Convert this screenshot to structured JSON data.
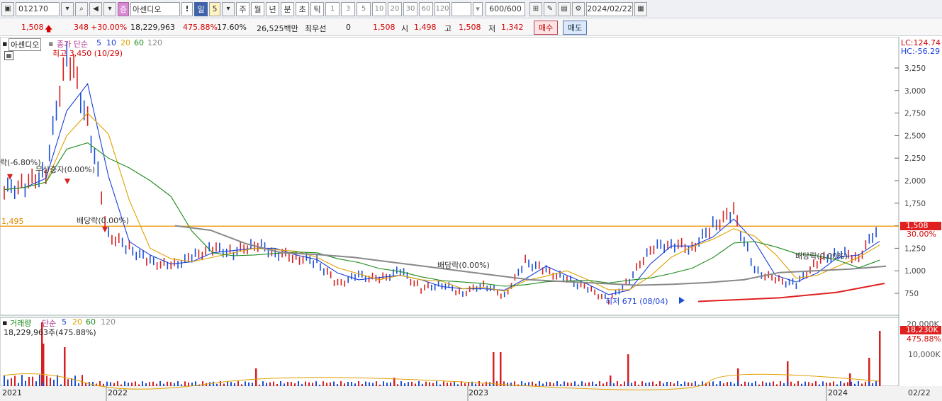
{
  "toolbar": {
    "stock_code": "012170",
    "stock_name": "아센디오",
    "badge": "증",
    "alert": "!",
    "period_day": "일",
    "period_value": "5",
    "period_week": "주",
    "period_month": "월",
    "period_year": "년",
    "period_minute": "분",
    "period_second": "초",
    "period_tick": "틱",
    "intervals": [
      "1",
      "3",
      "5",
      "10",
      "20",
      "30",
      "60",
      "120"
    ],
    "count": "600/600",
    "date": "2024/02/22"
  },
  "quote": {
    "price": "1,508",
    "change": "348",
    "change_pct": "+30.00%",
    "volume": "18,229,963",
    "volume_ratio": "475.88%",
    "turnover": "17.60%",
    "amount": "26,525백만",
    "best_bid_label": "최우선",
    "best_bid_qty": "0",
    "best_bid_price": "1,508",
    "open_label": "시",
    "open": "1,498",
    "high_label": "고",
    "high": "1,508",
    "low_label": "저",
    "low": "1,342",
    "buy_label": "매수",
    "sell_label": "매도"
  },
  "price_panel": {
    "title": "아센디오",
    "legend_prefix": "종가 단순",
    "legend_ma": [
      {
        "label": "5",
        "color": "#1a3fd6"
      },
      {
        "label": "10",
        "color": "#1a3fd6"
      },
      {
        "label": "20",
        "color": "#e0a000"
      },
      {
        "label": "60",
        "color": "#1c8a1c"
      },
      {
        "label": "120",
        "color": "#888888"
      }
    ],
    "lc": "LC:124.74",
    "hc": "HC:-56.29",
    "high_marker": "최고 3,450 (10/29)",
    "low_marker": "최저 671 (08/04)",
    "event_rights": "락(-6.80%)",
    "event_capital": "무상증자(0.00%)",
    "event_div1": "배당락(0.00%)",
    "event_div2": "배당락(0.00%)",
    "event_div3": "배당락(0.00%)",
    "hline_value": "1,495",
    "current_price_tag": "1,508",
    "current_pct_tag": "30.00%"
  },
  "volume_panel": {
    "title": "거래량",
    "legend_prefix": "단순",
    "legend_ma": [
      {
        "label": "5",
        "color": "#1a3fd6"
      },
      {
        "label": "20",
        "color": "#e0a000"
      },
      {
        "label": "60",
        "color": "#1c8a1c"
      },
      {
        "label": "120",
        "color": "#888888"
      }
    ],
    "current": "18,229,963주(475.88%)",
    "axis_top": "20,000K",
    "current_tag": "18,230K",
    "pct_tag": "475.88%",
    "axis_mid": "10,000K"
  },
  "xaxis": {
    "labels": [
      "2021",
      "2022",
      "2023",
      "2024"
    ],
    "right_date": "02/22"
  },
  "chart_data": {
    "type": "line",
    "title": "아센디오",
    "y_axis_ticks": [
      3250,
      3000,
      2750,
      2500,
      2250,
      2000,
      1750,
      1500,
      1250,
      1000,
      750
    ],
    "ylim": [
      600,
      3500
    ],
    "x": [
      "2021",
      "2022",
      "2023",
      "2024"
    ],
    "series": [
      {
        "name": "종가",
        "values": [
          1900,
          1950,
          2100,
          3450,
          2700,
          1400,
          1250,
          1100,
          1050,
          1150,
          1250,
          1200,
          1300,
          1200,
          1150,
          1100,
          850,
          950,
          900,
          1000,
          800,
          850,
          750,
          850,
          720,
          1100,
          1000,
          900,
          800,
          671,
          900,
          1250,
          1300,
          1250,
          1500,
          1650,
          1000,
          900,
          850,
          1100,
          1200,
          1150,
          1508
        ]
      },
      {
        "name": "120",
        "values": [
          1500,
          1450,
          1300,
          1200,
          1180,
          1150,
          1100,
          1050,
          1000,
          950,
          900,
          880,
          860,
          840,
          850,
          870,
          900,
          980,
          1000,
          1020,
          1050
        ]
      }
    ],
    "volume_axis": [
      "20,000K",
      "10,000K"
    ]
  }
}
